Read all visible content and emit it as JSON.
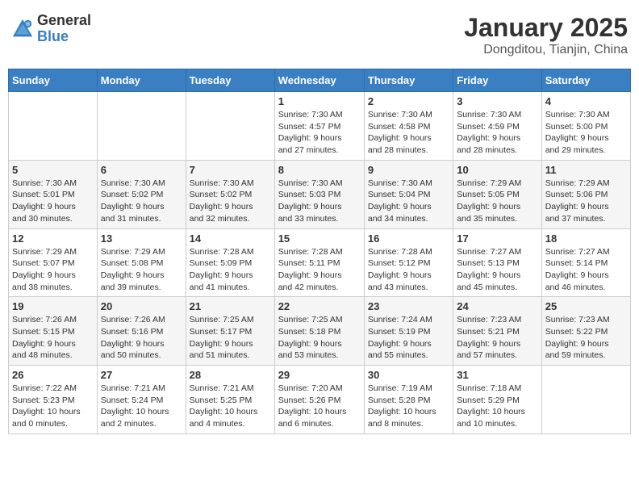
{
  "header": {
    "logo_line1": "General",
    "logo_line2": "Blue",
    "title": "January 2025",
    "subtitle": "Dongditou, Tianjin, China"
  },
  "weekdays": [
    "Sunday",
    "Monday",
    "Tuesday",
    "Wednesday",
    "Thursday",
    "Friday",
    "Saturday"
  ],
  "weeks": [
    [
      {
        "day": "",
        "info": ""
      },
      {
        "day": "",
        "info": ""
      },
      {
        "day": "",
        "info": ""
      },
      {
        "day": "1",
        "info": "Sunrise: 7:30 AM\nSunset: 4:57 PM\nDaylight: 9 hours\nand 27 minutes."
      },
      {
        "day": "2",
        "info": "Sunrise: 7:30 AM\nSunset: 4:58 PM\nDaylight: 9 hours\nand 28 minutes."
      },
      {
        "day": "3",
        "info": "Sunrise: 7:30 AM\nSunset: 4:59 PM\nDaylight: 9 hours\nand 28 minutes."
      },
      {
        "day": "4",
        "info": "Sunrise: 7:30 AM\nSunset: 5:00 PM\nDaylight: 9 hours\nand 29 minutes."
      }
    ],
    [
      {
        "day": "5",
        "info": "Sunrise: 7:30 AM\nSunset: 5:01 PM\nDaylight: 9 hours\nand 30 minutes."
      },
      {
        "day": "6",
        "info": "Sunrise: 7:30 AM\nSunset: 5:02 PM\nDaylight: 9 hours\nand 31 minutes."
      },
      {
        "day": "7",
        "info": "Sunrise: 7:30 AM\nSunset: 5:02 PM\nDaylight: 9 hours\nand 32 minutes."
      },
      {
        "day": "8",
        "info": "Sunrise: 7:30 AM\nSunset: 5:03 PM\nDaylight: 9 hours\nand 33 minutes."
      },
      {
        "day": "9",
        "info": "Sunrise: 7:30 AM\nSunset: 5:04 PM\nDaylight: 9 hours\nand 34 minutes."
      },
      {
        "day": "10",
        "info": "Sunrise: 7:29 AM\nSunset: 5:05 PM\nDaylight: 9 hours\nand 35 minutes."
      },
      {
        "day": "11",
        "info": "Sunrise: 7:29 AM\nSunset: 5:06 PM\nDaylight: 9 hours\nand 37 minutes."
      }
    ],
    [
      {
        "day": "12",
        "info": "Sunrise: 7:29 AM\nSunset: 5:07 PM\nDaylight: 9 hours\nand 38 minutes."
      },
      {
        "day": "13",
        "info": "Sunrise: 7:29 AM\nSunset: 5:08 PM\nDaylight: 9 hours\nand 39 minutes."
      },
      {
        "day": "14",
        "info": "Sunrise: 7:28 AM\nSunset: 5:09 PM\nDaylight: 9 hours\nand 41 minutes."
      },
      {
        "day": "15",
        "info": "Sunrise: 7:28 AM\nSunset: 5:11 PM\nDaylight: 9 hours\nand 42 minutes."
      },
      {
        "day": "16",
        "info": "Sunrise: 7:28 AM\nSunset: 5:12 PM\nDaylight: 9 hours\nand 43 minutes."
      },
      {
        "day": "17",
        "info": "Sunrise: 7:27 AM\nSunset: 5:13 PM\nDaylight: 9 hours\nand 45 minutes."
      },
      {
        "day": "18",
        "info": "Sunrise: 7:27 AM\nSunset: 5:14 PM\nDaylight: 9 hours\nand 46 minutes."
      }
    ],
    [
      {
        "day": "19",
        "info": "Sunrise: 7:26 AM\nSunset: 5:15 PM\nDaylight: 9 hours\nand 48 minutes."
      },
      {
        "day": "20",
        "info": "Sunrise: 7:26 AM\nSunset: 5:16 PM\nDaylight: 9 hours\nand 50 minutes."
      },
      {
        "day": "21",
        "info": "Sunrise: 7:25 AM\nSunset: 5:17 PM\nDaylight: 9 hours\nand 51 minutes."
      },
      {
        "day": "22",
        "info": "Sunrise: 7:25 AM\nSunset: 5:18 PM\nDaylight: 9 hours\nand 53 minutes."
      },
      {
        "day": "23",
        "info": "Sunrise: 7:24 AM\nSunset: 5:19 PM\nDaylight: 9 hours\nand 55 minutes."
      },
      {
        "day": "24",
        "info": "Sunrise: 7:23 AM\nSunset: 5:21 PM\nDaylight: 9 hours\nand 57 minutes."
      },
      {
        "day": "25",
        "info": "Sunrise: 7:23 AM\nSunset: 5:22 PM\nDaylight: 9 hours\nand 59 minutes."
      }
    ],
    [
      {
        "day": "26",
        "info": "Sunrise: 7:22 AM\nSunset: 5:23 PM\nDaylight: 10 hours\nand 0 minutes."
      },
      {
        "day": "27",
        "info": "Sunrise: 7:21 AM\nSunset: 5:24 PM\nDaylight: 10 hours\nand 2 minutes."
      },
      {
        "day": "28",
        "info": "Sunrise: 7:21 AM\nSunset: 5:25 PM\nDaylight: 10 hours\nand 4 minutes."
      },
      {
        "day": "29",
        "info": "Sunrise: 7:20 AM\nSunset: 5:26 PM\nDaylight: 10 hours\nand 6 minutes."
      },
      {
        "day": "30",
        "info": "Sunrise: 7:19 AM\nSunset: 5:28 PM\nDaylight: 10 hours\nand 8 minutes."
      },
      {
        "day": "31",
        "info": "Sunrise: 7:18 AM\nSunset: 5:29 PM\nDaylight: 10 hours\nand 10 minutes."
      },
      {
        "day": "",
        "info": ""
      }
    ]
  ]
}
